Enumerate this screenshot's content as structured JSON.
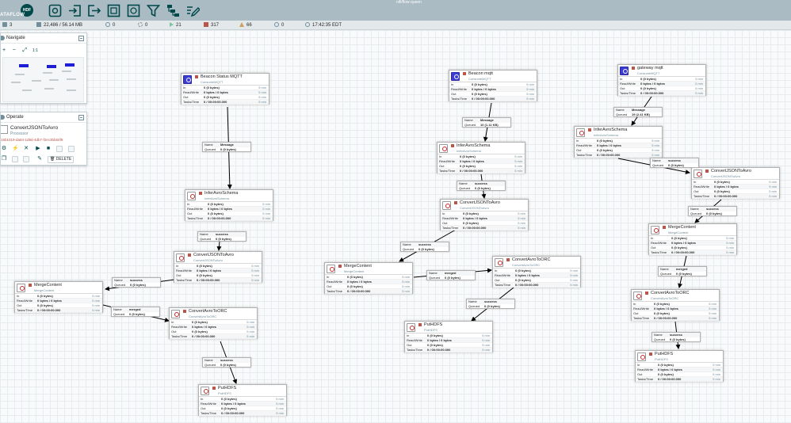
{
  "header": {
    "logo_badge": "HDF",
    "logo_text": "ATAFLOW",
    "user_id": "nifi/flow queen",
    "toolbar": [
      {
        "name": "processor-tool-icon"
      },
      {
        "name": "input-port-tool-icon"
      },
      {
        "name": "output-port-tool-icon"
      },
      {
        "name": "process-group-tool-icon"
      },
      {
        "name": "remote-process-group-tool-icon"
      },
      {
        "name": "funnel-tool-icon"
      },
      {
        "name": "template-tool-icon"
      },
      {
        "name": "label-tool-icon"
      }
    ]
  },
  "status": {
    "cluster": "3",
    "queued": "22,486 / 56.14 MB",
    "transmitting": "0",
    "not_transmitting": "0",
    "running": "21",
    "stopped": "317",
    "invalid": "66",
    "disabled": "0",
    "last_refresh": "17:42:35 EDT"
  },
  "navigate": {
    "title": "Navigate",
    "tools": [
      "+",
      "−",
      "⤢",
      "1:1"
    ]
  },
  "operate": {
    "title": "Operate",
    "selected_name": "ConvertJSONToAvro",
    "selected_type": "Processor",
    "selected_id": "15b1019-da84-1d9d-4db7-f2ec3bb84f9",
    "delete_label": "DELETE"
  },
  "row_labels": {
    "in": "In",
    "rw": "Read/Write",
    "out": "Out",
    "tasks": "Tasks/Time"
  },
  "conn_labels": {
    "name": "Name",
    "queued": "Queued"
  },
  "processors": [
    {
      "name": "Beacon Status MQTT",
      "type": "ConsumeMQTT",
      "mqtt": true,
      "in": "0 (0 bytes)",
      "rw": "0 bytes / 0 bytes",
      "out": "0 (0 bytes)",
      "tasks": "0 / 00:00:00.000",
      "time": "5 min"
    },
    {
      "name": "InferAvroSchema",
      "type": "InferAvroSchema",
      "mqtt": false,
      "in": "0 (0 bytes)",
      "rw": "0 bytes / 0 bytes",
      "out": "0 (0 bytes)",
      "tasks": "0 / 00:00:00.000",
      "time": "5 min"
    },
    {
      "name": "ConvertJSONToAvro",
      "type": "ConvertJSONToAvro",
      "mqtt": false,
      "in": "0 (0 bytes)",
      "rw": "0 bytes / 0 bytes",
      "out": "0 (0 bytes)",
      "tasks": "0 / 00:00:00.000",
      "time": "5 min"
    },
    {
      "name": "MergeContent",
      "type": "MergeContent",
      "mqtt": false,
      "in": "0 (0 bytes)",
      "rw": "0 bytes / 0 bytes",
      "out": "0 (0 bytes)",
      "tasks": "0 / 00:00:00.000",
      "time": "5 min"
    },
    {
      "name": "ConvertAvroToORC",
      "type": "ConvertAvroToORC",
      "mqtt": false,
      "in": "0 (0 bytes)",
      "rw": "0 bytes / 0 bytes",
      "out": "0 (0 bytes)",
      "tasks": "0 / 00:00:00.000",
      "time": "5 min"
    },
    {
      "name": "PutHDFS",
      "type": "PutHDFS",
      "mqtt": false,
      "in": "0 (0 bytes)",
      "rw": "0 bytes / 0 bytes",
      "out": "0 (0 bytes)",
      "tasks": "0 / 00:00:00.000",
      "time": "5 min"
    },
    {
      "name": "Beacon mqtt",
      "type": "ConsumeMQTT",
      "mqtt": true,
      "in": "0 (0 bytes)",
      "rw": "0 bytes / 0 bytes",
      "out": "0 (0 bytes)",
      "tasks": "0 / 00:00:00.000",
      "time": "5 min"
    },
    {
      "name": "InferAvroSchema",
      "type": "InferAvroSchema",
      "mqtt": false,
      "in": "0 (0 bytes)",
      "rw": "0 bytes / 0 bytes",
      "out": "0 (0 bytes)",
      "tasks": "0 / 00:00:00.000",
      "time": "5 min"
    },
    {
      "name": "ConvertJSONToAvro",
      "type": "ConvertJSONToAvro",
      "mqtt": false,
      "in": "0 (0 bytes)",
      "rw": "0 bytes / 0 bytes",
      "out": "0 (0 bytes)",
      "tasks": "0 / 00:00:00.000",
      "time": "5 min"
    },
    {
      "name": "MergeContent",
      "type": "MergeContent",
      "mqtt": false,
      "in": "0 (0 bytes)",
      "rw": "0 bytes / 0 bytes",
      "out": "0 (0 bytes)",
      "tasks": "0 / 00:00:00.000",
      "time": "5 min"
    },
    {
      "name": "ConvertAvroToORC",
      "type": "ConvertAvroToORC",
      "mqtt": false,
      "in": "0 (0 bytes)",
      "rw": "0 bytes / 0 bytes",
      "out": "0 (0 bytes)",
      "tasks": "0 / 00:00:00.000",
      "time": "5 min"
    },
    {
      "name": "PutHDFS",
      "type": "PutHDFS",
      "mqtt": false,
      "in": "0 (0 bytes)",
      "rw": "0 bytes / 0 bytes",
      "out": "0 (0 bytes)",
      "tasks": "0 / 00:00:00.000",
      "time": "5 min"
    },
    {
      "name": "gateway mqtt",
      "type": "ConsumeMQTT",
      "mqtt": true,
      "in": "0 (0 bytes)",
      "rw": "0 bytes / 0 bytes",
      "out": "0 (0 bytes)",
      "tasks": "0 / 00:00:00.000",
      "time": "5 min"
    },
    {
      "name": "InferAvroSchema",
      "type": "InferAvroSchema",
      "mqtt": false,
      "in": "0 (0 bytes)",
      "rw": "0 bytes / 0 bytes",
      "out": "0 (0 bytes)",
      "tasks": "0 / 00:00:00.000",
      "time": "5 min"
    },
    {
      "name": "ConvertJSONToAvro",
      "type": "ConvertJSONToAvro",
      "mqtt": false,
      "in": "0 (0 bytes)",
      "rw": "0 bytes / 0 bytes",
      "out": "0 (0 bytes)",
      "tasks": "0 / 00:00:00.000",
      "time": "5 min"
    },
    {
      "name": "MergeContent",
      "type": "MergeContent",
      "mqtt": false,
      "in": "0 (0 bytes)",
      "rw": "0 bytes / 0 bytes",
      "out": "0 (0 bytes)",
      "tasks": "0 / 00:00:00.000",
      "time": "5 min"
    },
    {
      "name": "ConvertAvroToORC",
      "type": "ConvertAvroToORC",
      "mqtt": false,
      "in": "0 (0 bytes)",
      "rw": "0 bytes / 0 bytes",
      "out": "0 (0 bytes)",
      "tasks": "0 / 00:00:00.000",
      "time": "5 min"
    },
    {
      "name": "PutHDFS",
      "type": "PutHDFS",
      "mqtt": false,
      "in": "0 (0 bytes)",
      "rw": "0 bytes / 0 bytes",
      "out": "0 (0 bytes)",
      "tasks": "0 / 00:00:00.000",
      "time": "5 min"
    }
  ],
  "connections": [
    {
      "name": "Message",
      "queued": "0 (0 bytes)"
    },
    {
      "name": "success",
      "queued": "0 (0 bytes)"
    },
    {
      "name": "success",
      "queued": "0 (0 bytes)"
    },
    {
      "name": "merged",
      "queued": "0 (0 bytes)"
    },
    {
      "name": "success",
      "queued": "0 (0 bytes)"
    },
    {
      "name": "Message",
      "queued": "10 (1.11 KB)"
    },
    {
      "name": "success",
      "queued": "0 (0 bytes)"
    },
    {
      "name": "success",
      "queued": "0 (0 bytes)"
    },
    {
      "name": "merged",
      "queued": "0 (0 bytes)"
    },
    {
      "name": "success",
      "queued": "0 (0 bytes)"
    },
    {
      "name": "Message",
      "queued": "19 (2.41 KB)"
    },
    {
      "name": "success",
      "queued": "0 (0 bytes)"
    },
    {
      "name": "success",
      "queued": "0 (0 bytes)"
    },
    {
      "name": "merged",
      "queued": "0 (0 bytes)"
    },
    {
      "name": "success",
      "queued": "0 (0 bytes)"
    }
  ]
}
